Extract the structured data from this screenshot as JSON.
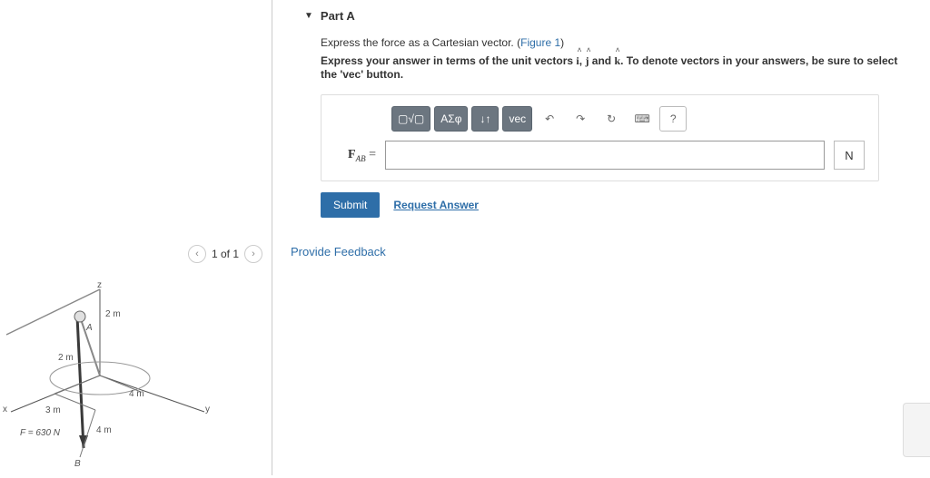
{
  "pager": {
    "text": "1 of 1"
  },
  "part": {
    "title": "Part A",
    "prompt_before": "Express the force as a Cartesian vector. (",
    "figure_link": "Figure 1",
    "prompt_after": ")",
    "instruction_prefix": "Express your answer in terms of the unit vectors ",
    "uv1": "i",
    "uvsep1": ", ",
    "uv2": "j",
    "uvsep2": " and ",
    "uv3": "k",
    "instruction_suffix": ". To denote vectors in your answers, be sure to select the 'vec' button."
  },
  "toolbar": {
    "templates": "▢√▢",
    "greek": "ΑΣφ",
    "subsup": "↓↑",
    "vec": "vec",
    "undo": "↶",
    "redo": "↷",
    "reset": "↻",
    "keyboard": "⌨",
    "help": "?"
  },
  "answer": {
    "label_vec": "F",
    "label_sub": "AB",
    "label_eq": " =",
    "value": "",
    "unit": "N"
  },
  "submit_label": "Submit",
  "request_label": "Request Answer",
  "feedback_label": "Provide Feedback",
  "figure": {
    "axis_z": "z",
    "axis_x": "x",
    "axis_y": "y",
    "d1": "2 m",
    "d2": "2 m",
    "d3": "3 m",
    "d4": "4 m",
    "d5": "4 m",
    "ptA": "A",
    "ptB": "B",
    "force": "F = 630 N"
  }
}
